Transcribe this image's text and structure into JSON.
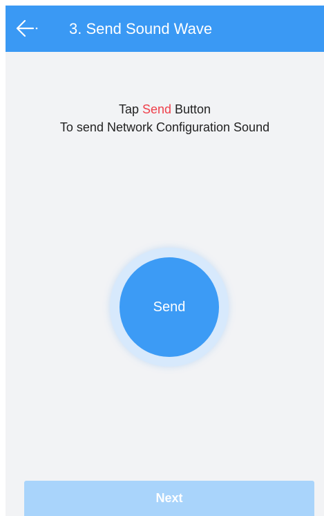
{
  "header": {
    "title": "3. Send Sound Wave",
    "back_icon": "arrow-left-icon"
  },
  "instructions": {
    "line1_prefix": "Tap ",
    "line1_highlight": "Send",
    "line1_suffix": " Button",
    "line2": "To send Network Configuration Sound"
  },
  "send_button": {
    "label": "Send"
  },
  "next_button": {
    "label": "Next"
  },
  "colors": {
    "header_bg": "#3a99f4",
    "highlight_text": "#ef3f4a",
    "send_button_bg": "#3c9bf5",
    "send_halo": "#d7e9fc",
    "next_button_bg": "#a9d4fb",
    "page_bg": "#f2f3f5"
  }
}
